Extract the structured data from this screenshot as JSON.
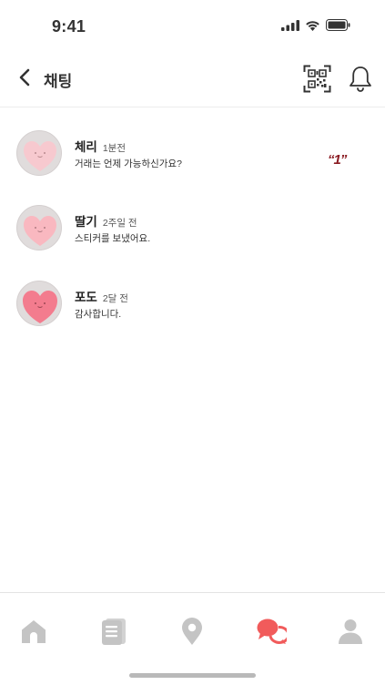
{
  "status_bar": {
    "time": "9:41",
    "icons": [
      "signal-icon",
      "wifi-icon",
      "battery-icon"
    ]
  },
  "header": {
    "title": "채팅",
    "icons": [
      "back-arrow-icon",
      "qr-code-icon",
      "bell-icon"
    ]
  },
  "chats": [
    {
      "name": "체리",
      "time": "1분전",
      "preview": "거래는 언제 가능하신가요?",
      "unread": "“1”",
      "avatar_color": "#f7c9cf"
    },
    {
      "name": "딸기",
      "time": "2주일 전",
      "preview": "스티커를 보냈어요.",
      "unread": "",
      "avatar_color": "#f9b8c0"
    },
    {
      "name": "포도",
      "time": "2달 전",
      "preview": "감사합니다.",
      "unread": "",
      "avatar_color": "#f37c8e"
    }
  ],
  "bottom_nav": {
    "items": [
      "home-icon",
      "document-icon",
      "location-pin-icon",
      "chat-icon",
      "profile-icon"
    ],
    "active": "chat-icon",
    "active_color": "#f15b5b",
    "inactive_color": "#c4c4c4"
  }
}
